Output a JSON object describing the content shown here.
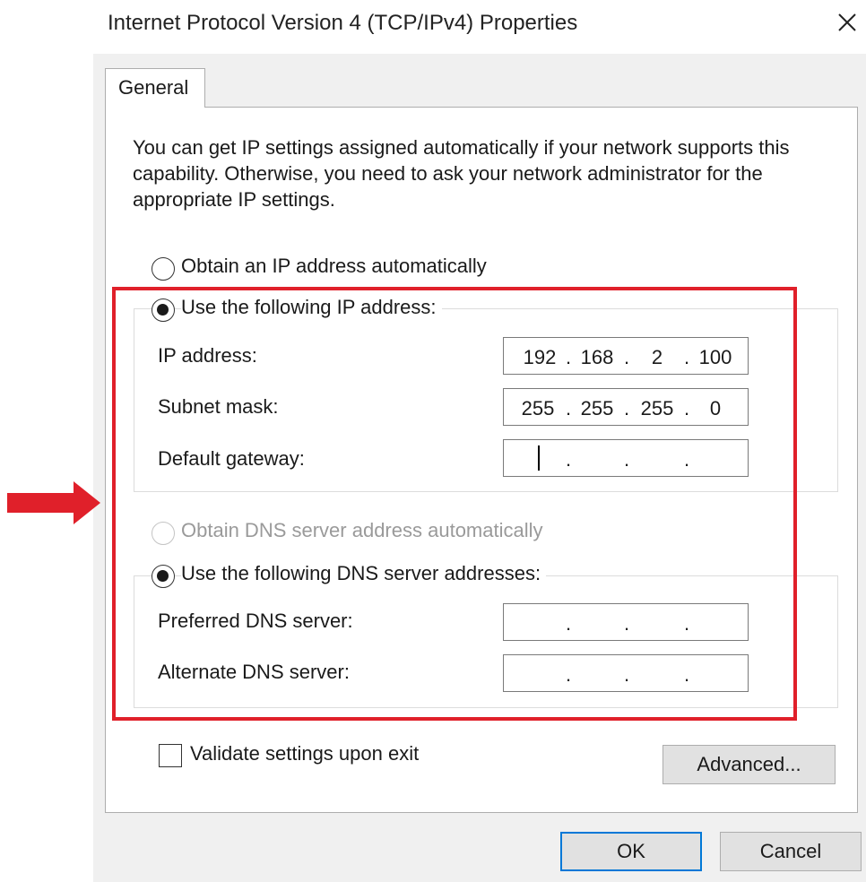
{
  "window": {
    "title": "Internet Protocol Version 4 (TCP/IPv4) Properties",
    "close_icon": "close-icon"
  },
  "tabs": [
    {
      "label": "General",
      "selected": true
    }
  ],
  "intro_text": "You can get IP settings assigned automatically if your network supports this capability. Otherwise, you need to ask your network administrator for the appropriate IP settings.",
  "ip_section": {
    "auto_option": {
      "label": "Obtain an IP address automatically",
      "selected": false,
      "enabled": true
    },
    "manual_option": {
      "label": "Use the following IP address:",
      "selected": true,
      "enabled": true
    },
    "fields": [
      {
        "label": "IP address:",
        "octets": [
          "192",
          "168",
          "2",
          "100"
        ]
      },
      {
        "label": "Subnet mask:",
        "octets": [
          "255",
          "255",
          "255",
          "0"
        ]
      },
      {
        "label": "Default gateway:",
        "octets": [
          "",
          "",
          "",
          ""
        ],
        "focused": true
      }
    ]
  },
  "dns_section": {
    "auto_option": {
      "label": "Obtain DNS server address automatically",
      "selected": false,
      "enabled": false
    },
    "manual_option": {
      "label": "Use the following DNS server addresses:",
      "selected": true,
      "enabled": true
    },
    "fields": [
      {
        "label": "Preferred DNS server:",
        "octets": [
          "",
          "",
          "",
          ""
        ]
      },
      {
        "label": "Alternate DNS server:",
        "octets": [
          "",
          "",
          "",
          ""
        ]
      }
    ]
  },
  "validate": {
    "label": "Validate settings upon exit",
    "checked": false
  },
  "buttons": {
    "advanced": "Advanced...",
    "ok": "OK",
    "cancel": "Cancel"
  },
  "annotation": {
    "highlight_color": "#e0202a",
    "arrow_icon": "right-arrow-icon"
  },
  "colors": {
    "accent": "#0078d7",
    "dialog_bg": "#f0f0f0"
  }
}
